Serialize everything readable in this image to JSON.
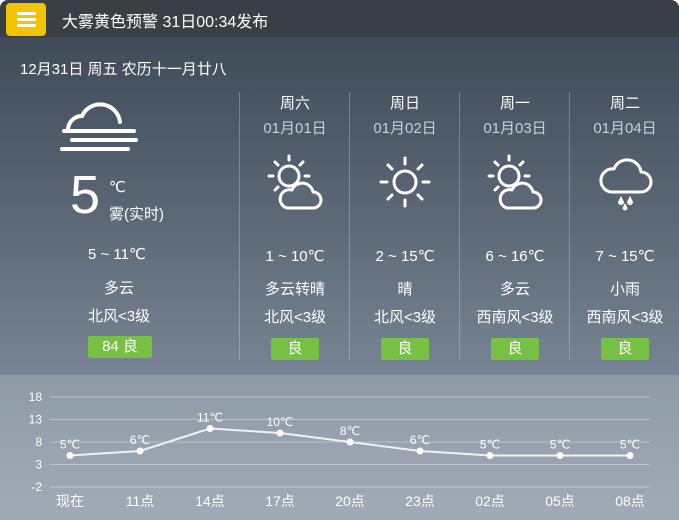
{
  "alert": {
    "text": "大雾黄色预警 31日00:34发布",
    "menu_icon": "hamburger-menu-icon"
  },
  "date_line": "12月31日 周五 农历十一月廿八",
  "today": {
    "icon": "fog-icon",
    "temp": "5",
    "unit": "℃",
    "desc": "雾(实时)",
    "range": "5 ~ 11℃",
    "condition": "多云",
    "wind": "北风<3级",
    "aqi": "84 良"
  },
  "forecast": [
    {
      "weekday": "周六",
      "date": "01月01日",
      "icon": "partly-cloudy-icon",
      "range": "1 ~ 10℃",
      "condition": "多云转晴",
      "wind": "北风<3级",
      "aqi": "良"
    },
    {
      "weekday": "周日",
      "date": "01月02日",
      "icon": "sunny-icon",
      "range": "2 ~ 15℃",
      "condition": "晴",
      "wind": "北风<3级",
      "aqi": "良"
    },
    {
      "weekday": "周一",
      "date": "01月03日",
      "icon": "partly-cloudy-icon",
      "range": "6 ~ 16℃",
      "condition": "多云",
      "wind": "西南风<3级",
      "aqi": "良"
    },
    {
      "weekday": "周二",
      "date": "01月04日",
      "icon": "light-rain-icon",
      "range": "7 ~ 15℃",
      "condition": "小雨",
      "wind": "西南风<3级",
      "aqi": "良"
    }
  ],
  "colors": {
    "aqi_good": "#76c043",
    "alert": "#f3c300"
  },
  "chart_data": {
    "type": "line",
    "categories": [
      "现在",
      "11点",
      "14点",
      "17点",
      "20点",
      "23点",
      "02点",
      "05点",
      "08点"
    ],
    "values": [
      5,
      6,
      11,
      10,
      8,
      6,
      5,
      5,
      5
    ],
    "point_labels": [
      "5℃",
      "6℃",
      "11℃",
      "10℃",
      "8℃",
      "6℃",
      "5℃",
      "5℃",
      "5℃"
    ],
    "yticks": [
      18,
      13,
      8,
      3,
      -2
    ],
    "ylim": [
      -2,
      18
    ],
    "grid": true
  }
}
